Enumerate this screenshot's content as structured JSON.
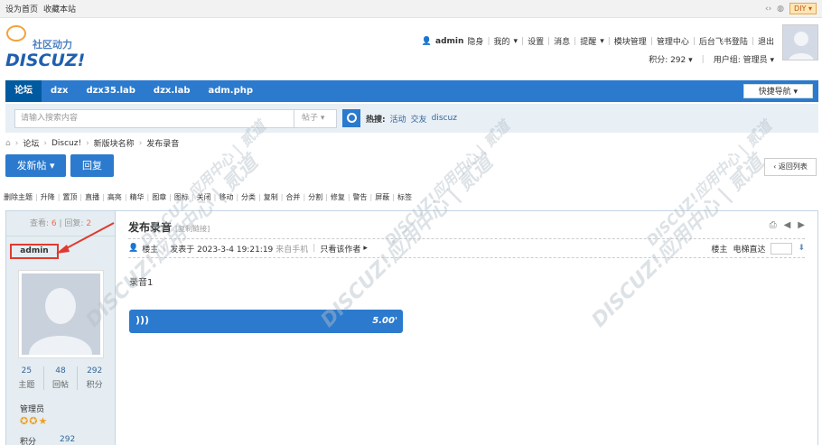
{
  "topbar": {
    "set_home": "设为首页",
    "bookmark": "收藏本站",
    "diy": "DIY"
  },
  "logo": {
    "cn": "社区动力",
    "en": "DISCUZ!"
  },
  "user_menu": {
    "username": "admin",
    "stealth": "隐身",
    "items": [
      "我的",
      "设置",
      "消息",
      "提醒",
      "模块管理",
      "管理中心",
      "后台飞书登陆",
      "退出"
    ],
    "credits": "积分: 292",
    "usergroup": "用户组: 管理员"
  },
  "nav": {
    "items": [
      "论坛",
      "dzx",
      "dzx35.lab",
      "dzx.lab",
      "adm.php"
    ],
    "quick": "快捷导航"
  },
  "search": {
    "placeholder": "请输入搜索内容",
    "type": "帖子",
    "hot_label": "热搜:",
    "hot": [
      "活动",
      "交友",
      "discuz"
    ]
  },
  "breadcrumb": [
    "论坛",
    "Discuz!",
    "新版块名称",
    "发布录音"
  ],
  "buttons": {
    "post": "发新帖",
    "reply": "回复",
    "back": "返回列表"
  },
  "mod_tools": [
    "删除主题",
    "升降",
    "置顶",
    "直播",
    "高亮",
    "精华",
    "图章",
    "图标",
    "关闭",
    "移动",
    "分类",
    "复制",
    "合并",
    "分割",
    "修复",
    "警告",
    "屏蔽",
    "标签"
  ],
  "thread": {
    "views_label": "查看:",
    "views": "6",
    "replies_label": "回复:",
    "replies": "2",
    "title": "发布录音",
    "copy_link": "[复制链接]",
    "author_tag": "楼主",
    "posted_at": "发表于 2023-3-4 19:21:19",
    "from_mobile": "来自手机",
    "only_author": "只看该作者",
    "floor": "楼主",
    "jump_label": "电梯直达",
    "content": "录音1",
    "audio_duration": "5.00'"
  },
  "author": {
    "name": "admin",
    "stats": [
      {
        "value": "25",
        "label": "主题"
      },
      {
        "value": "48",
        "label": "回帖"
      },
      {
        "value": "292",
        "label": "积分"
      }
    ],
    "group": "管理员",
    "credit_label": "积分",
    "credit_value": "292"
  },
  "watermark": "DISCUZ!应用中心 | 贰道"
}
